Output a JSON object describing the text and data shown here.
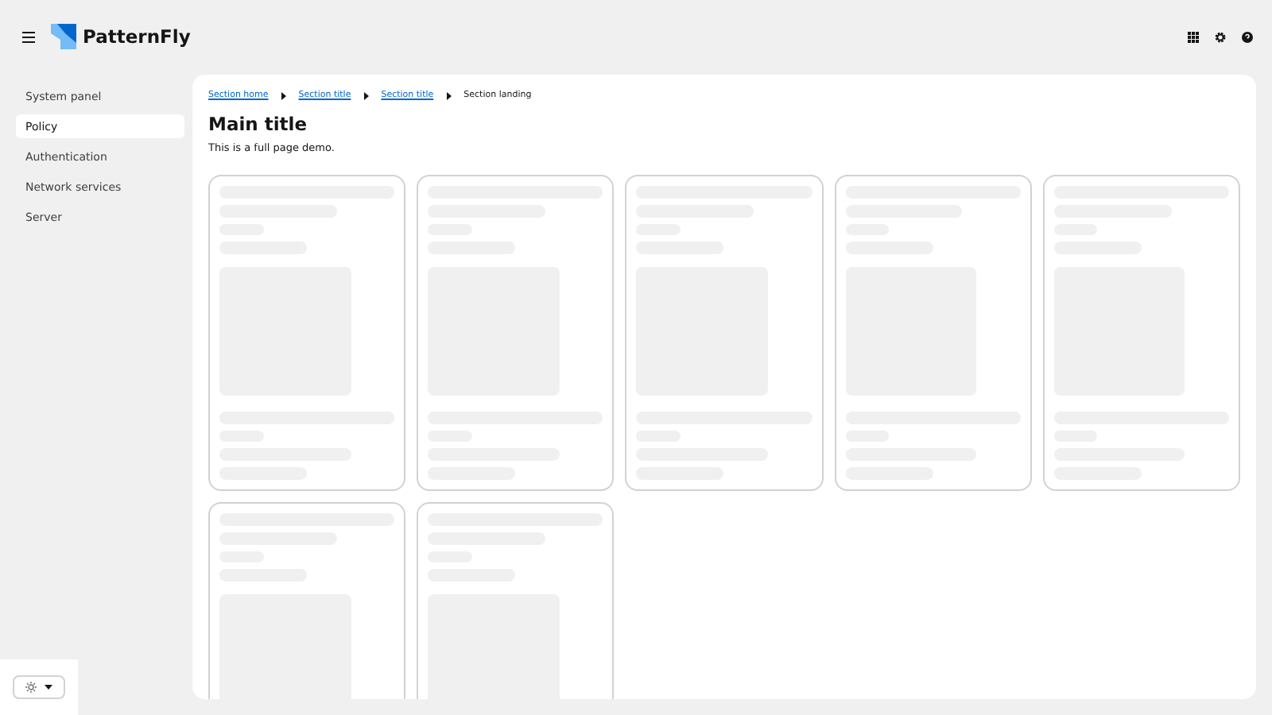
{
  "header": {
    "brand": "PatternFly"
  },
  "sidebar": {
    "items": [
      {
        "label": "System panel",
        "selected": false
      },
      {
        "label": "Policy",
        "selected": true
      },
      {
        "label": "Authentication",
        "selected": false
      },
      {
        "label": "Network services",
        "selected": false
      },
      {
        "label": "Server",
        "selected": false
      }
    ]
  },
  "breadcrumb": [
    {
      "label": "Section home",
      "kind": "link"
    },
    {
      "label": "Section title",
      "kind": "link"
    },
    {
      "label": "Section title",
      "kind": "link"
    },
    {
      "label": "Section landing",
      "kind": "current"
    }
  ],
  "theme_toggle": {
    "expanded": false
  },
  "page": {
    "title": "Main title",
    "description": "This is a full page demo."
  },
  "cards": [
    {
      "kind": "skeleton"
    },
    {
      "kind": "skeleton"
    },
    {
      "kind": "skeleton"
    },
    {
      "kind": "skeleton"
    },
    {
      "kind": "skeleton"
    },
    {
      "kind": "skeleton"
    },
    {
      "kind": "skeleton"
    }
  ]
}
